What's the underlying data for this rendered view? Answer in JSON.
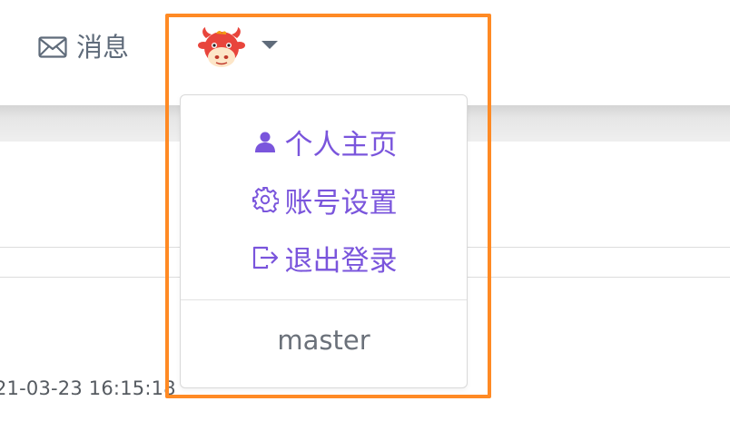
{
  "header": {
    "messages_label": "消息",
    "messages_icon": "mail-icon",
    "avatar_icon": "cow-avatar",
    "caret_icon": "caret-down-icon"
  },
  "dropdown": {
    "items": [
      {
        "label": "个人主页",
        "icon": "user-icon"
      },
      {
        "label": "账号设置",
        "icon": "gear-icon"
      },
      {
        "label": "退出登录",
        "icon": "logout-icon"
      }
    ],
    "username": "master"
  },
  "content": {
    "timestamp": "21-03-23 16:15:18"
  },
  "colors": {
    "accent": "#7a55dc",
    "highlight": "#ff8a24",
    "muted_text": "#6b717a"
  }
}
